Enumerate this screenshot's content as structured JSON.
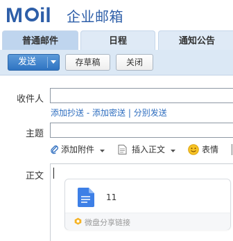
{
  "header": {
    "logo_text": "Mail",
    "product_name": "企业邮箱"
  },
  "tabs": [
    {
      "label": "普通邮件",
      "active": true
    },
    {
      "label": "日程",
      "active": false
    },
    {
      "label": "通知公告",
      "active": false
    }
  ],
  "toolbar": {
    "send_label": "发送",
    "draft_label": "存草稿",
    "close_label": "关闭"
  },
  "compose": {
    "to_label": "收件人",
    "to_value": "",
    "add_cc": "添加抄送",
    "dash": "-",
    "add_bcc": "添加密送",
    "pipe": "|",
    "separate_send": "分别发送",
    "subject_label": "主题",
    "subject_value": "",
    "add_attachment": "添加附件",
    "insert_body": "插入正文",
    "emoji": "表情",
    "body_label": "正文"
  },
  "share_card": {
    "file_name": "11",
    "link_text": "微盘分享链接"
  },
  "colors": {
    "brand": "#2d5ea8",
    "link": "#2d6dbf",
    "send_button": "#3b7cc9",
    "toolbar_bg": "#dbe8f5"
  }
}
